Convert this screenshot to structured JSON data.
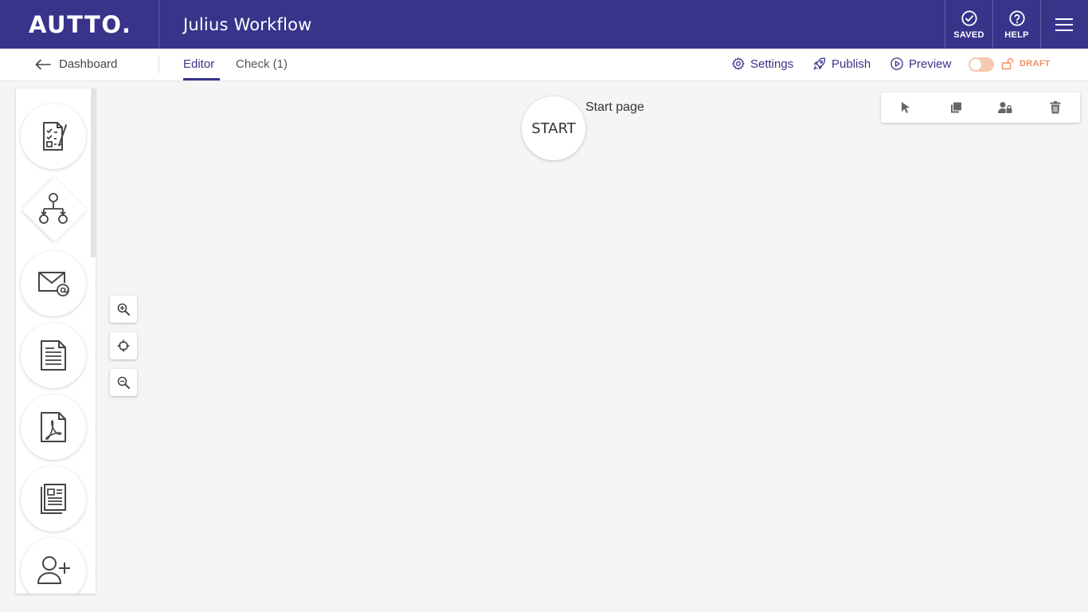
{
  "header": {
    "logo": "AUTTO.",
    "title": "Julius Workflow",
    "saved_label": "SAVED",
    "help_label": "HELP"
  },
  "subbar": {
    "back_label": "Dashboard",
    "tabs": [
      {
        "label": "Editor",
        "active": true
      },
      {
        "label": "Check (1)",
        "active": false
      }
    ],
    "settings_label": "Settings",
    "publish_label": "Publish",
    "preview_label": "Preview",
    "draft_label": "DRAFT"
  },
  "palette": {
    "items": [
      {
        "icon": "form-icon"
      },
      {
        "icon": "branch-icon"
      },
      {
        "icon": "email-icon"
      },
      {
        "icon": "document-icon"
      },
      {
        "icon": "pdf-icon"
      },
      {
        "icon": "newsletter-icon"
      },
      {
        "icon": "add-user-icon"
      }
    ]
  },
  "canvas": {
    "start_node_label": "START",
    "start_node_caption": "Start page"
  },
  "colors": {
    "brand": "#37348a",
    "draft": "#f39060",
    "canvas": "#f5f5f5"
  }
}
